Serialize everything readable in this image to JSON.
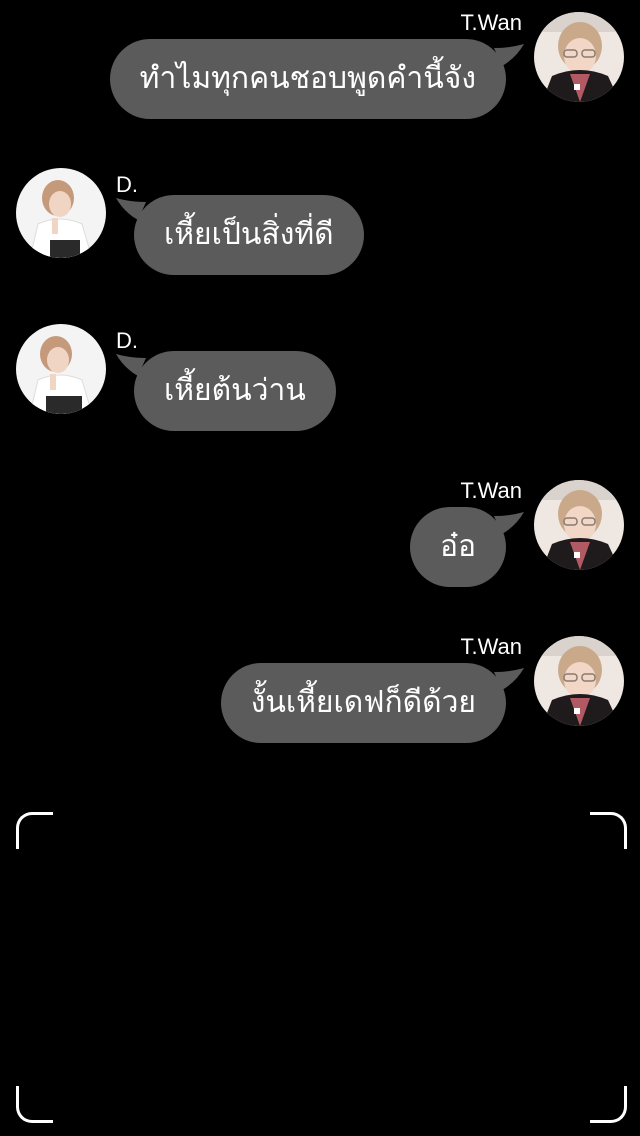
{
  "colors": {
    "background": "#000000",
    "bubble": "#5b5b5b",
    "text": "#ffffff"
  },
  "messages": [
    {
      "side": "right",
      "sender": "T.Wan",
      "avatar": "t-wan-avatar",
      "text": "ทำไมทุกคนชอบพูดคำนี้จัง"
    },
    {
      "side": "left",
      "sender": "D.",
      "avatar": "d-avatar",
      "text": "เหี้ยเป็นสิ่งที่ดี"
    },
    {
      "side": "left",
      "sender": "D.",
      "avatar": "d-avatar",
      "text": "เหี้ยต้นว่าน"
    },
    {
      "side": "right",
      "sender": "T.Wan",
      "avatar": "t-wan-avatar",
      "text": "อ๋อ"
    },
    {
      "side": "right",
      "sender": "T.Wan",
      "avatar": "t-wan-avatar",
      "text": "งั้นเหี้ยเดฟก็ดีด้วย"
    }
  ],
  "capture_frame": {
    "icon": "camera-viewfinder-corners"
  }
}
